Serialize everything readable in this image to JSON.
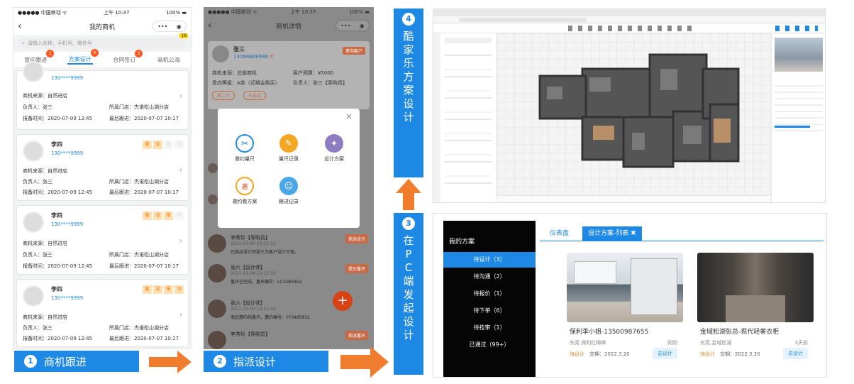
{
  "phone1": {
    "status": {
      "carrier": "●●●●● 中国移动 ᯤ",
      "time": "上午 10:37",
      "battery": "100%"
    },
    "title": "我的商机",
    "search_placeholder": "请输入名称、手机号、微信号",
    "highlight": "18",
    "tabs": [
      {
        "label": "意向跟进",
        "badge": "1"
      },
      {
        "label": "方案设计",
        "badge": "4"
      },
      {
        "label": "合同签订",
        "badge": "2"
      },
      {
        "label": "商机公海",
        "badge": ""
      }
    ],
    "cards": [
      {
        "name": "",
        "phone": "130****9999",
        "source": "商机来源：自然进店",
        "owner": "负责人：张三",
        "store": "所属门店：杰诺松山湖分店",
        "report": "报备时间：2020-07-09 12:45",
        "last": "最后跟进：2020-07-07 10:17",
        "tags": []
      },
      {
        "name": "李四",
        "phone": "130****9999",
        "source": "商机来源：自然进店",
        "owner": "负责人：张三",
        "store": "所属门店：杰诺松山湖分店",
        "report": "报备时间：2020-07-09 12:45",
        "last": "最后跟进：2020-07-07 10:17",
        "tags": [
          "量",
          "设",
          "报",
          "沟"
        ]
      },
      {
        "name": "李四",
        "phone": "130****9999",
        "source": "商机来源：自然进店",
        "owner": "负责人：张三",
        "store": "所属门店：杰诺松山湖分店",
        "report": "报备时间：2020-07-09 12:45",
        "last": "最后跟进：2020-07-07 10:17",
        "tags": [
          "量",
          "设",
          "报",
          "沟"
        ]
      },
      {
        "name": "李四",
        "phone": "130****9999",
        "source": "商机来源：自然进店",
        "owner": "负责人：张三",
        "store": "所属门店：杰诺松山湖分店",
        "report": "报备时间：2020-07-09 12:45",
        "last": "最后跟进：2020-07-07 10:17",
        "tags": [
          "量",
          "设",
          "报",
          "沟"
        ]
      }
    ]
  },
  "label1": {
    "num": "1",
    "text": "商机跟进"
  },
  "phone2": {
    "status": {
      "carrier": "●●●●● 中国移动 ᯤ",
      "time": "上午 10:37",
      "battery": "100%"
    },
    "title": "商机详情",
    "customer": {
      "name": "张三",
      "phone": "13066668888",
      "stage": "意向客户",
      "source": "商机来源：总部商机",
      "budget": "客户预算：¥5000",
      "level": "意向等级：A类（近期会购买）",
      "owner": "负责人：张三【导购员】",
      "tags": [
        "第二代",
        "头条店"
      ]
    },
    "modal": {
      "close": "×",
      "items": [
        "邀约量尺",
        "量尺记录",
        "设计方案",
        "邀约看方案",
        "跟进记录"
      ]
    },
    "messages": [
      {
        "name": "李秀珍【导购员】",
        "date": "2021-03-04 10:21:52",
        "content": "已指派设计师张三为客户设计方案。",
        "button": "指派设计"
      },
      {
        "name": "张六【设计师】",
        "date": "2021-03-04 10:21:52",
        "content": "量尺已完成，量尺编号：LC3485952",
        "button": "提交量尺"
      },
      {
        "name": "张六【设计师】",
        "date": "2021-03-04 10:21:52",
        "content": "发起邀约线量尺，邀约编号：YY3485952",
        "button": ""
      },
      {
        "name": "李秀珍【导购员】",
        "date": "",
        "content": "",
        "button": "指派量尺"
      }
    ],
    "fab": "+"
  },
  "label2": {
    "num": "2",
    "text": "指派设计"
  },
  "label3": {
    "num": "3",
    "chars": [
      "在",
      "P",
      "C",
      "端",
      "发",
      "起",
      "设",
      "计"
    ]
  },
  "label4": {
    "num": "4",
    "chars": [
      "酷",
      "家",
      "乐",
      "方",
      "案",
      "设",
      "计"
    ]
  },
  "pc": {
    "sidebar_title": "我的方案",
    "sidebar_items": [
      "待设计（3）",
      "待沟通（2）",
      "待报价（1）",
      "待下单（6）",
      "待技审（1）",
      "已通过（99+）"
    ],
    "tabs": [
      "仪表盘",
      "设计方案-列表 ✖"
    ],
    "cards": [
      {
        "title": "保利李小姐-13500987655",
        "location": "东莞 保利红棉峰",
        "meta": "刚刚",
        "status": "待设计",
        "date": "交期：2022.3.20",
        "button": "去设计"
      },
      {
        "title": "金域松湖张总-现代轻奢衣柜",
        "location": "东莞 金域松湖",
        "meta": "3天前",
        "status": "待设计",
        "date": "交期：2022.3.20",
        "button": "去设计"
      }
    ]
  }
}
